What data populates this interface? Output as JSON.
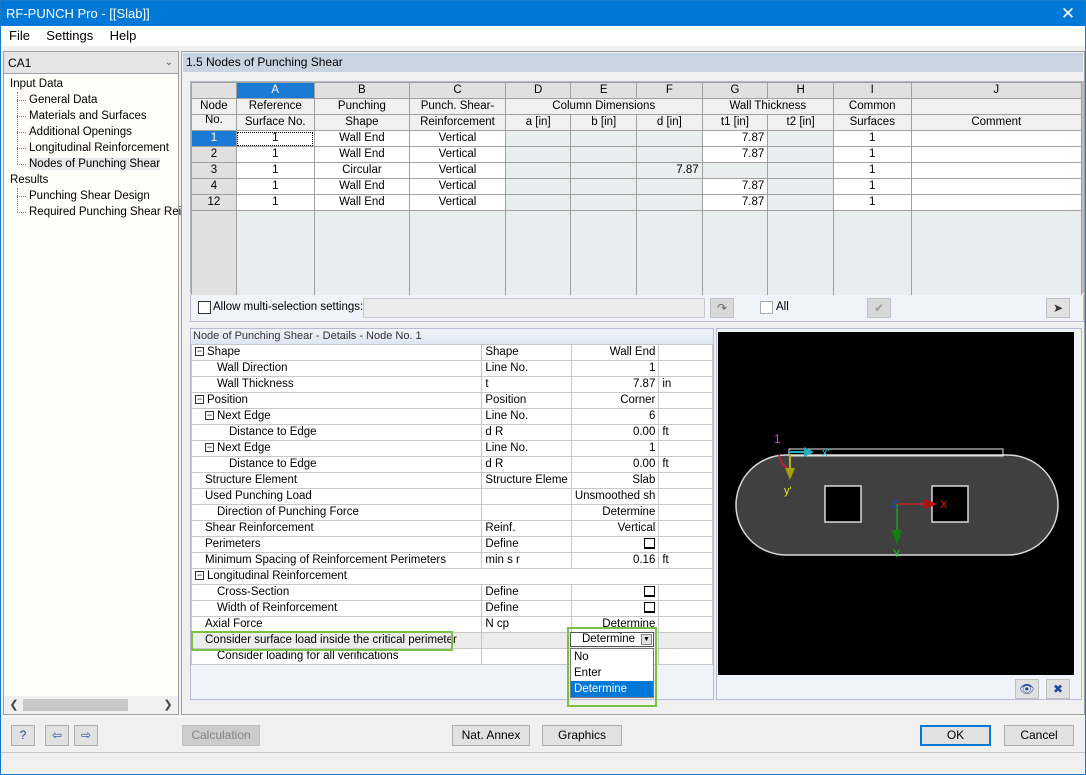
{
  "window": {
    "title": "RF-PUNCH Pro - [[Slab]]",
    "close_glyph": "✕"
  },
  "menu": [
    "File",
    "Settings",
    "Help"
  ],
  "case_selector": {
    "value": "CA1"
  },
  "nav": {
    "groups": [
      {
        "label": "Input Data",
        "items": [
          "General Data",
          "Materials and Surfaces",
          "Additional Openings",
          "Longitudinal Reinforcement",
          "Nodes of Punching Shear"
        ]
      },
      {
        "label": "Results",
        "items": [
          "Punching Shear Design",
          "Required Punching Shear Reinf"
        ]
      }
    ],
    "selected": "Nodes of Punching Shear"
  },
  "section_title": "1.5 Nodes of Punching Shear",
  "table": {
    "col_letters": [
      "A",
      "B",
      "C",
      "D",
      "E",
      "F",
      "G",
      "H",
      "I",
      "J"
    ],
    "node_header": [
      "Node",
      "No."
    ],
    "headers": {
      "A": [
        "Reference",
        "Surface No."
      ],
      "B": [
        "Punching",
        "Shape"
      ],
      "C": [
        "Punch. Shear-",
        "Reinforcement"
      ],
      "DEF_group": "Column Dimensions",
      "D": "a [in]",
      "E": "b [in]",
      "F": "d [in]",
      "GH_group": "Wall Thickness",
      "G": "t1 [in]",
      "H": "t2 [in]",
      "I": [
        "Common",
        "Surfaces"
      ],
      "J": "Comment"
    },
    "rows": [
      {
        "node": "1",
        "A": "1",
        "B": "Wall End",
        "C": "Vertical",
        "D": "",
        "E": "",
        "F": "",
        "G": "7.87",
        "H": "",
        "I": "1",
        "J": ""
      },
      {
        "node": "2",
        "A": "1",
        "B": "Wall End",
        "C": "Vertical",
        "D": "",
        "E": "",
        "F": "",
        "G": "7.87",
        "H": "",
        "I": "1",
        "J": ""
      },
      {
        "node": "3",
        "A": "1",
        "B": "Circular",
        "C": "Vertical",
        "D": "",
        "E": "",
        "F": "7.87",
        "G": "",
        "H": "",
        "I": "1",
        "J": ""
      },
      {
        "node": "4",
        "A": "1",
        "B": "Wall End",
        "C": "Vertical",
        "D": "",
        "E": "",
        "F": "",
        "G": "7.87",
        "H": "",
        "I": "1",
        "J": ""
      },
      {
        "node": "12",
        "A": "1",
        "B": "Wall End",
        "C": "Vertical",
        "D": "",
        "E": "",
        "F": "",
        "G": "7.87",
        "H": "",
        "I": "1",
        "J": ""
      }
    ]
  },
  "multiselect": {
    "label": "Allow multi-selection settings:",
    "all_label": "All",
    "value": ""
  },
  "details": {
    "title": "Node of Punching Shear - Details - Node No.  1",
    "rows": [
      {
        "label": "Shape",
        "sym": "Shape",
        "value": "Wall End",
        "unit": "",
        "level": 0,
        "expander": true
      },
      {
        "label": "Wall Direction",
        "sym": "Line No.",
        "value": "1",
        "unit": "",
        "level": 1
      },
      {
        "label": "Wall Thickness",
        "sym": "t",
        "value": "7.87",
        "unit": "in",
        "level": 1
      },
      {
        "label": "Position",
        "sym": "Position",
        "value": "Corner",
        "unit": "",
        "level": 0,
        "expander": true
      },
      {
        "label": "Next Edge",
        "sym": "Line No.",
        "value": "6",
        "unit": "",
        "level": 1,
        "expander": true
      },
      {
        "label": "Distance to Edge",
        "sym": "d R",
        "value": "0.00",
        "unit": "ft",
        "level": 2
      },
      {
        "label": "Next Edge",
        "sym": "Line No.",
        "value": "1",
        "unit": "",
        "level": 1,
        "expander": true
      },
      {
        "label": "Distance to Edge",
        "sym": "d R",
        "value": "0.00",
        "unit": "ft",
        "level": 2
      },
      {
        "label": "Structure Element",
        "sym": "Structure Eleme",
        "value": "Slab",
        "unit": "",
        "level": 0
      },
      {
        "label": "Used Punching Load",
        "sym": "",
        "value": "Unsmoothed sh",
        "unit": "",
        "level": 0
      },
      {
        "label": "Direction of Punching Force",
        "sym": "",
        "value": "Determine",
        "unit": "",
        "level": 1
      },
      {
        "label": "Shear Reinforcement",
        "sym": "Reinf.",
        "value": "Vertical",
        "unit": "",
        "level": 0
      },
      {
        "label": "Perimeters",
        "sym": "Define",
        "value": "",
        "unit": "",
        "level": 0,
        "checkbox": true
      },
      {
        "label": "Minimum Spacing of Reinforcement Perimeters",
        "sym": "min s r",
        "value": "0.16",
        "unit": "ft",
        "level": 0
      },
      {
        "label": "Longitudinal Reinforcement",
        "sym": "",
        "value": "",
        "unit": "",
        "level": 0,
        "expander": true,
        "span": true
      },
      {
        "label": "Cross-Section",
        "sym": "Define",
        "value": "",
        "unit": "",
        "level": 1,
        "checkbox": true
      },
      {
        "label": "Width of Reinforcement",
        "sym": "Define",
        "value": "",
        "unit": "",
        "level": 1,
        "checkbox": true
      },
      {
        "label": "Axial Force",
        "sym": "N cp",
        "value": "Determine",
        "unit": "",
        "level": 0
      },
      {
        "label": "Consider surface load inside the critical perimeter",
        "sym": "",
        "value": "",
        "unit": "",
        "level": 0,
        "highlight": true
      },
      {
        "label": "Consider loading for all verifications",
        "sym": "",
        "value": "",
        "unit": "",
        "level": 1
      }
    ],
    "dropdown": {
      "selected": "Determine",
      "options": [
        "No",
        "Enter",
        "Determine"
      ]
    }
  },
  "graphics": {
    "node_label": "1",
    "local_axes": [
      "x'",
      "y'"
    ],
    "global_axes": [
      "X",
      "Y",
      "Z"
    ]
  },
  "buttons": {
    "calculation": "Calculation",
    "nat_annex": "Nat. Annex",
    "graphics": "Graphics",
    "ok": "OK",
    "cancel": "Cancel"
  }
}
